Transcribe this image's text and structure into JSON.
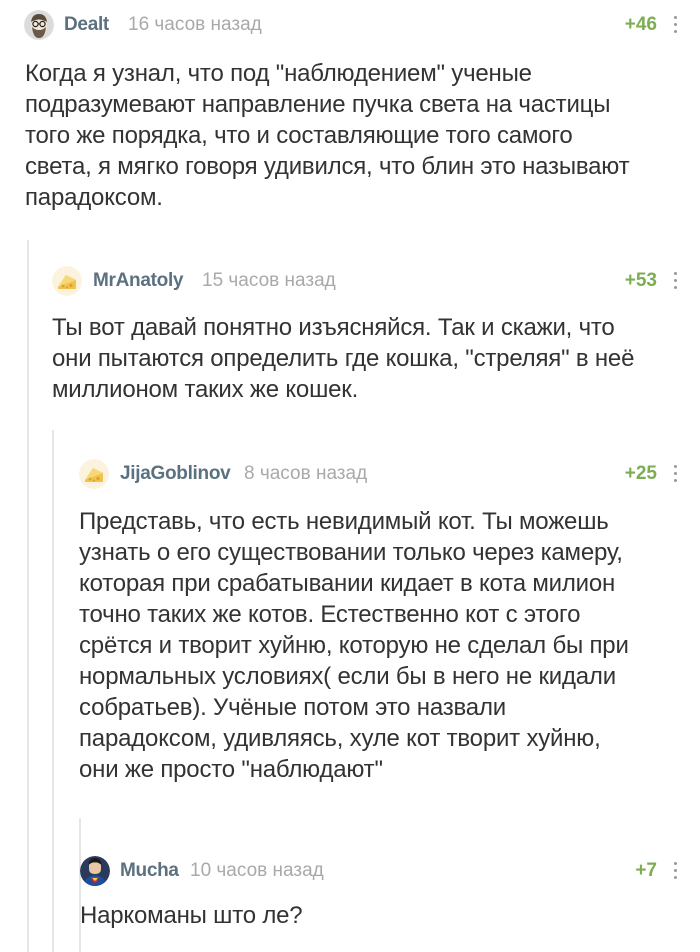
{
  "comments": [
    {
      "author": "Dealt",
      "time": "16 часов назад",
      "rating": "+46",
      "avatar_icon": "bearded-man-avatar",
      "text_lines": [
        "Когда я узнал, что под \"наблюдением\" ученые",
        "подразумевают направление пучка света на частицы",
        "того же порядка, что и составляющие того самого",
        "света, я мягко говоря удивился, что блин это называют",
        "парадоксом."
      ]
    },
    {
      "author": "MrAnatoly",
      "time": "15 часов назад",
      "rating": "+53",
      "avatar_icon": "cheese-avatar",
      "text_lines": [
        "Ты вот давай понятно изъясняйся. Так и скажи, что",
        "они пытаются определить где кошка, \"стреляя\" в неё",
        "миллионом таких же кошек."
      ]
    },
    {
      "author": "JijaGoblinov",
      "time": "8 часов назад",
      "rating": "+25",
      "avatar_icon": "cheese-avatar",
      "text_lines": [
        "Представь, что есть невидимый кот. Ты можешь",
        "узнать о его существовании только через камеру,",
        "которая при срабатывании кидает в кота милион",
        "точно таких же котов. Естественно кот с этого",
        "срётся и творит хуйню, которую не сделал бы при",
        "нормальных условиях( если бы в него не кидали",
        "собратьев). Учёные потом это назвали",
        "парадоксом, удивляясь, хуле кот творит хуйню,",
        "они же просто \"наблюдают\""
      ]
    },
    {
      "author": "Mucha",
      "time": "10 часов назад",
      "rating": "+7",
      "avatar_icon": "superman-avatar",
      "text_lines": [
        "Наркоманы што ле?"
      ]
    }
  ],
  "colors": {
    "author": "#5b7180",
    "time": "#a9a9a9",
    "rating": "#7dad52",
    "text": "#333333",
    "thread_line": "#e6e6e6"
  }
}
